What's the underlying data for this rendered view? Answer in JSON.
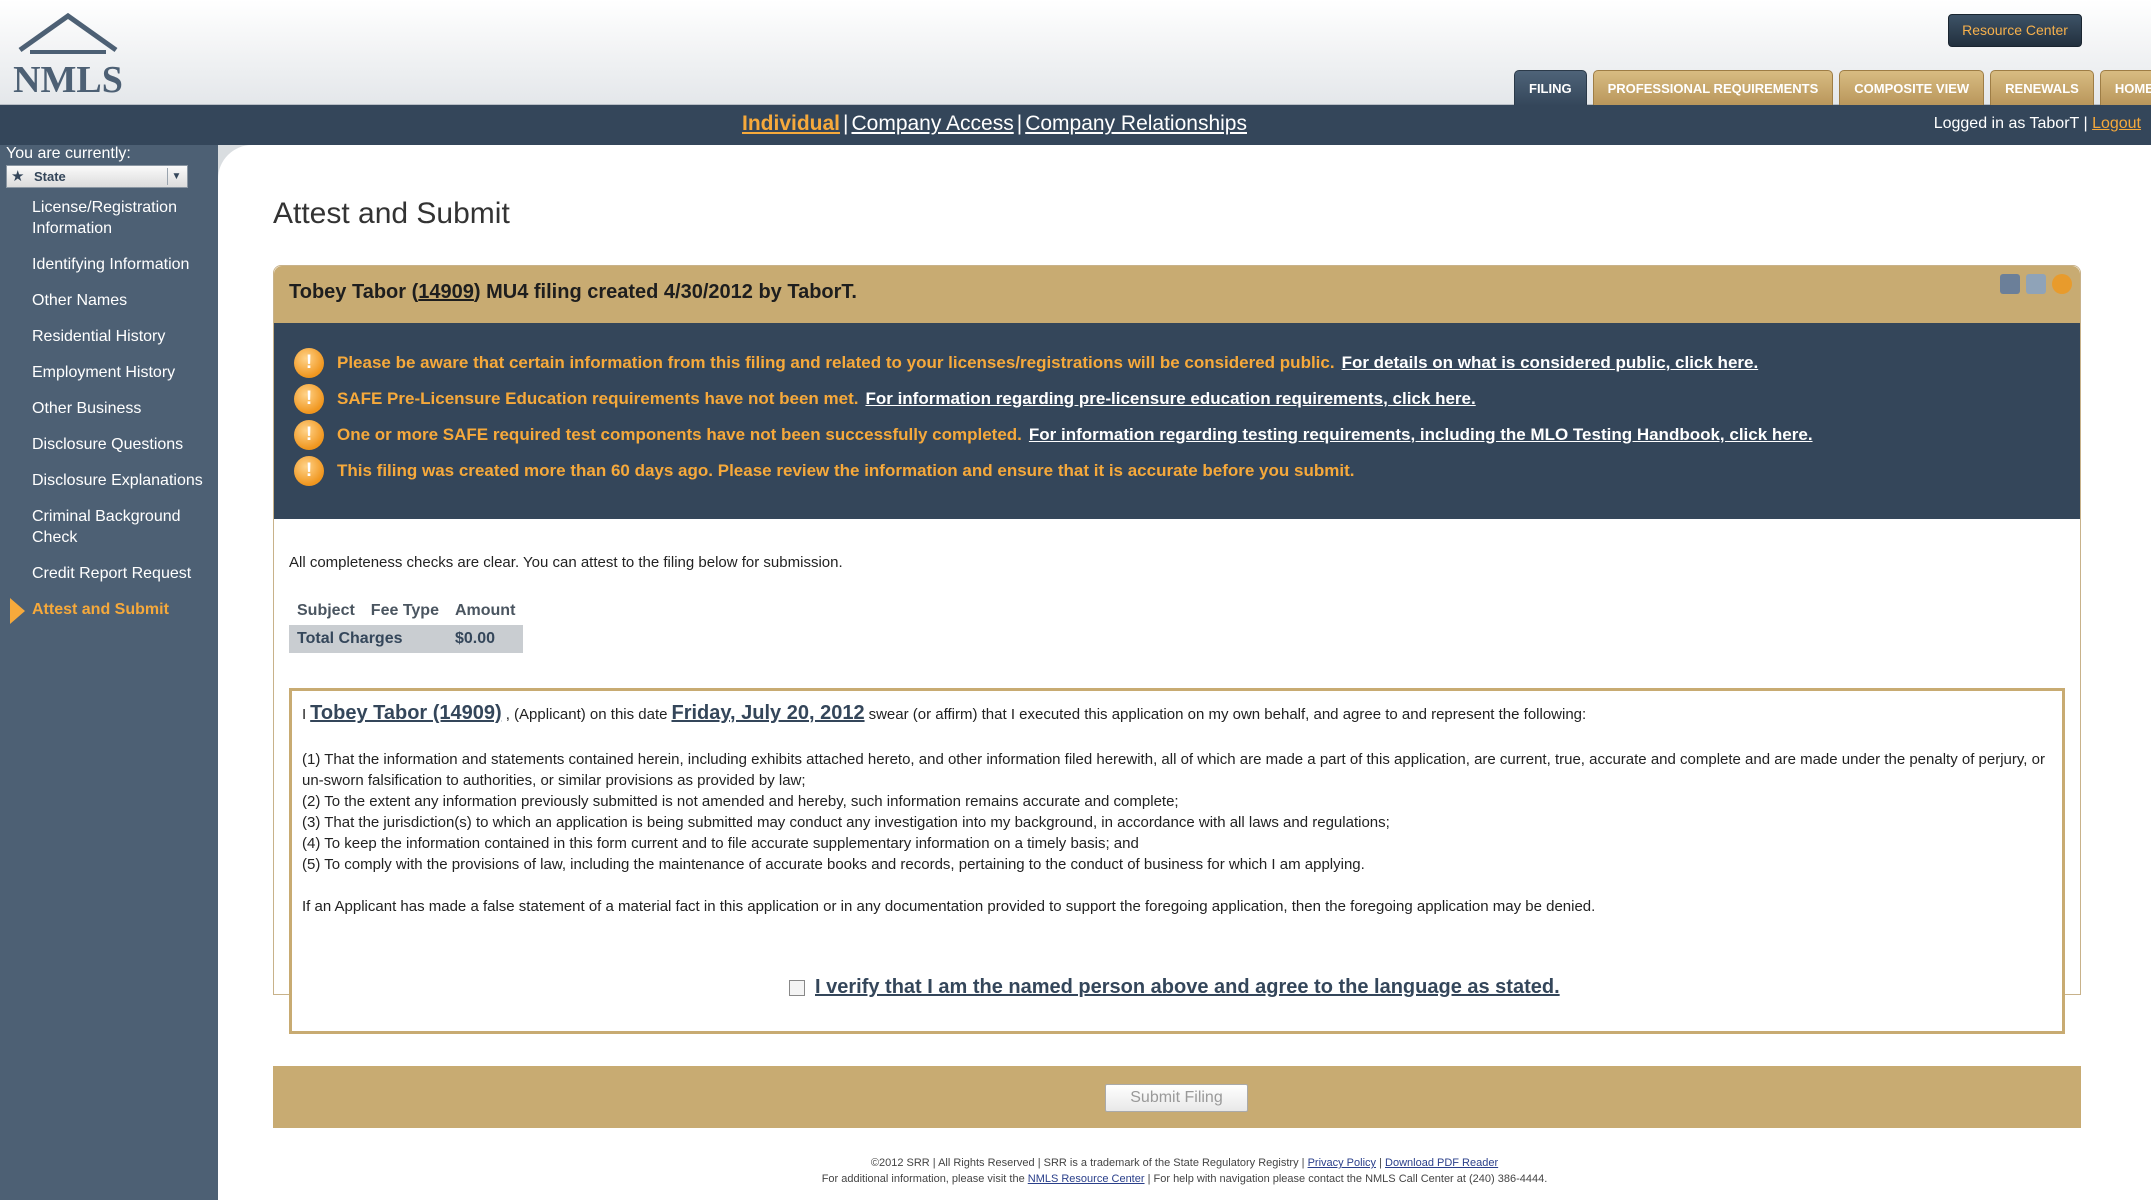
{
  "header": {
    "logo_text": "NMLS",
    "resource_center": "Resource Center",
    "tabs": [
      {
        "label": "FILING",
        "active": true
      },
      {
        "label": "PROFESSIONAL REQUIREMENTS",
        "active": false
      },
      {
        "label": "COMPOSITE VIEW",
        "active": false
      },
      {
        "label": "RENEWALS",
        "active": false
      },
      {
        "label": "HOME",
        "active": false
      }
    ]
  },
  "subnav": {
    "links": [
      "Individual",
      "Company Access",
      "Company Relationships"
    ],
    "separator": "|",
    "logged_in": "Logged in as TaborT",
    "logout": "Logout"
  },
  "sidebar": {
    "you_are": "You are currently:",
    "state_value": "State",
    "items": [
      "License/Registration Information",
      "Identifying Information",
      "Other Names",
      "Residential History",
      "Employment History",
      "Other Business",
      "Disclosure Questions",
      "Disclosure Explanations",
      "Criminal Background Check",
      "Credit Report Request",
      "Attest and Submit"
    ]
  },
  "main": {
    "page_title": "Attest and Submit",
    "filing_title_pre": "Tobey Tabor (",
    "filing_id": "14909",
    "filing_title_post": ") MU4 filing created 4/30/2012 by TaborT.",
    "warnings": [
      {
        "text": "Please be aware that certain information from this filing and related to your licenses/registrations will be considered public.",
        "link": "For details on what is considered public, click here."
      },
      {
        "text": "SAFE Pre-Licensure Education requirements have not been met.",
        "link": "For information regarding pre-licensure education requirements, click here."
      },
      {
        "text": "One or more SAFE required test components have not been successfully completed.",
        "link": "For information regarding testing requirements, including the MLO Testing Handbook, click here."
      },
      {
        "text": "This filing was created more than 60 days ago. Please review the information and ensure that it is accurate before you submit.",
        "link": ""
      }
    ],
    "check_message": "All completeness checks are clear. You can attest to the filing below for submission.",
    "fee_table": {
      "headers": [
        "Subject",
        "Fee Type",
        "Amount"
      ],
      "total_label": "Total Charges",
      "total_amount": "$0.00"
    },
    "attest": {
      "prefix": "I",
      "name": "Tobey Tabor (14909)",
      "mid": ", (Applicant) on this date",
      "date": "Friday, July 20, 2012",
      "suffix": "swear (or affirm) that I executed this application on my own behalf, and agree to and represent the following:",
      "clauses": [
        "(1) That the information and statements contained herein, including exhibits attached hereto, and other information filed herewith, all of which are made a part of this application, are current, true, accurate and complete and are made under the penalty of perjury, or un-sworn falsification to authorities, or similar provisions as provided by law;",
        "(2) To the extent any information previously submitted is not amended and hereby, such information remains accurate and complete;",
        "(3) That the jurisdiction(s) to which an application is being submitted may conduct any investigation into my background, in accordance with all laws and regulations;",
        "(4) To keep the information contained in this form current and to file accurate supplementary information on a timely basis; and",
        "(5) To comply with the provisions of law, including the maintenance of accurate books and records, pertaining to the conduct of business for which I am applying."
      ],
      "false_statement": "If an Applicant has made a false statement of a material fact in this application or in any documentation provided to support the foregoing application, then the foregoing application may be denied.",
      "verify_label": "I verify that I am the named person above and agree to the language as stated.",
      "verify_checked": false
    },
    "submit_label": "Submit Filing"
  },
  "footer": {
    "line1_pre": "©2012 SRR | All Rights Reserved | SRR is a trademark of the State Regulatory Registry |",
    "privacy": "Privacy Policy",
    "line1_sep": "|",
    "download": "Download PDF Reader",
    "line2_pre": "For additional information, please visit the",
    "resource_link": "NMLS Resource Center",
    "line2_post": "| For help with navigation please contact the NMLS Call Center at (240) 386-4444."
  },
  "colors": {
    "nav_dark": "#34465a",
    "sidebar": "#4d6074",
    "accent_orange": "#f6a93b",
    "tan": "#c8ab72"
  }
}
